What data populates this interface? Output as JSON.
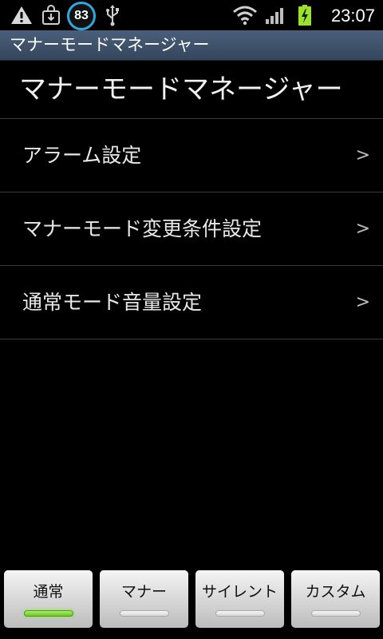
{
  "status_bar": {
    "battery_percent": "83",
    "battery_charging": true,
    "time": "23:07",
    "icons": [
      "warning-icon",
      "download-icon",
      "battery-percent-badge",
      "usb-icon",
      "wifi-icon",
      "signal-icon",
      "battery-icon"
    ]
  },
  "title_bar": {
    "title": "マナーモードマネージャー"
  },
  "page": {
    "heading": "マナーモードマネージャー"
  },
  "menu": {
    "items": [
      {
        "label": "アラーム設定",
        "arrow": ">"
      },
      {
        "label": "マナーモード変更条件設定",
        "arrow": ">"
      },
      {
        "label": "通常モード音量設定",
        "arrow": ">"
      }
    ]
  },
  "modes": {
    "buttons": [
      {
        "label": "通常",
        "active": true
      },
      {
        "label": "マナー",
        "active": false
      },
      {
        "label": "サイレント",
        "active": false
      },
      {
        "label": "カスタム",
        "active": false
      }
    ]
  },
  "colors": {
    "title_bar": "#3e5169",
    "active_indicator": "#7ad82f",
    "battery_ring": "#2fa8e0",
    "charging_battery": "#9be22d"
  }
}
